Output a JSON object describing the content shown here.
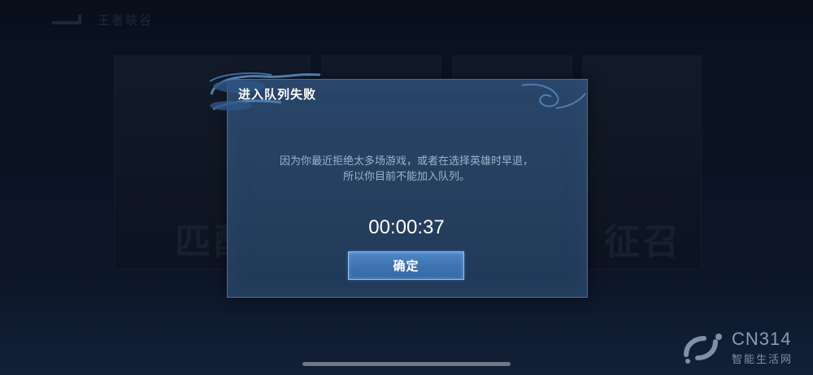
{
  "header": {
    "title": "王者峡谷"
  },
  "modes": [
    {
      "label": "匹配"
    },
    {
      "label": ""
    },
    {
      "label": ""
    },
    {
      "label": "征召"
    }
  ],
  "dialog": {
    "title": "进入队列失败",
    "message_line1": "因为你最近拒绝太多场游戏，或者在选择英雄时早退，",
    "message_line2": "所以你目前不能加入队列。",
    "countdown": "00:00:37",
    "confirm_label": "确定"
  },
  "watermark": {
    "brand": "CN314",
    "sub": "智能生活网"
  },
  "colors": {
    "dialog_bg": "#294568",
    "dialog_border": "#4b6c93",
    "button": "#4e86c6",
    "message_text": "#9fb2ca"
  }
}
